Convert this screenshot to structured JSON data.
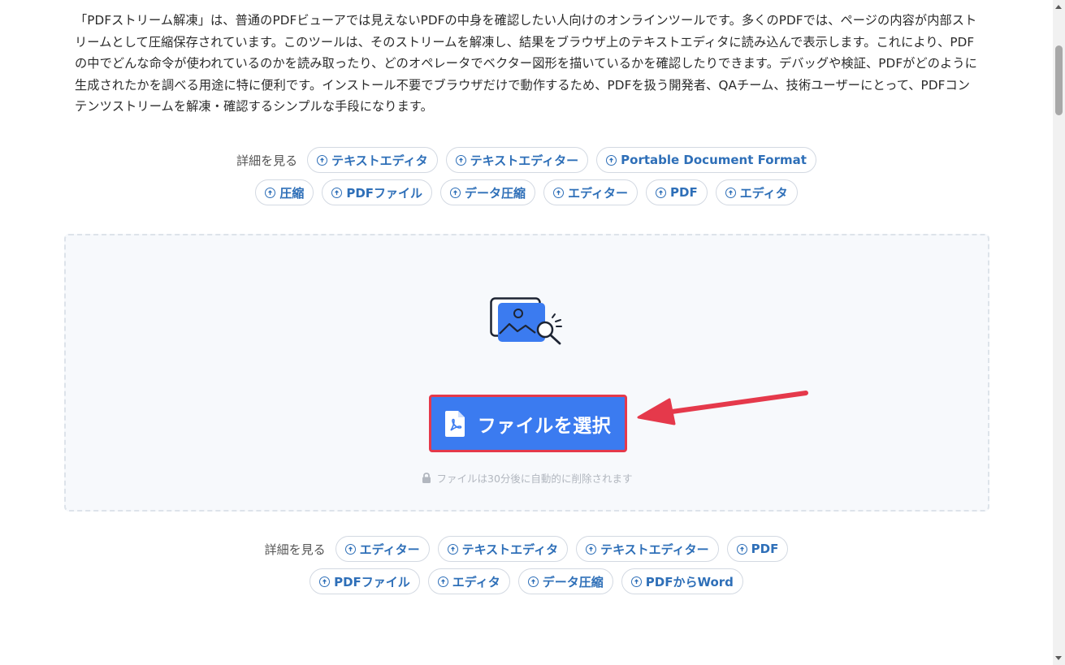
{
  "intro": {
    "text": "「PDFストリーム解凍」は、普通のPDFビューアでは見えないPDFの中身を確認したい人向けのオンラインツールです。多くのPDFでは、ページの内容が内部ストリームとして圧縮保存されています。このツールは、そのストリームを解凍し、結果をブラウザ上のテキストエディタに読み込んで表示します。これにより、PDFの中でどんな命令が使われているのかを読み取ったり、どのオペレータでベクター図形を描いているかを確認したりできます。デバッグや検証、PDFがどのように生成されたかを調べる用途に特に便利です。インストール不要でブラウザだけで動作するため、PDFを扱う開発者、QAチーム、技術ユーザーにとって、PDFコンテンツストリームを解凍・確認するシンプルな手段になります。"
  },
  "top_tags": {
    "label": "詳細を見る",
    "row1": [
      "テキストエディタ",
      "テキストエディター",
      "Portable Document Format"
    ],
    "row2": [
      "圧縮",
      "PDFファイル",
      "データ圧縮",
      "エディター",
      "PDF",
      "エディタ"
    ]
  },
  "upload": {
    "button_label": "ファイルを選択",
    "note": "ファイルは30分後に自動的に削除されます",
    "accent_color": "#3b7bf0",
    "highlight_color": "#e5394b"
  },
  "bottom_tags": {
    "label": "詳細を見る",
    "row1": [
      "エディター",
      "テキストエディタ",
      "テキストエディター",
      "PDF"
    ],
    "row2": [
      "PDFファイル",
      "エディタ",
      "データ圧縮",
      "PDFからWord"
    ]
  },
  "icons": {
    "chip": "arrow-circle-icon",
    "illustration": "image-search-icon",
    "button": "pdf-file-icon",
    "note": "lock-icon",
    "annotation": "red-arrow-icon"
  }
}
